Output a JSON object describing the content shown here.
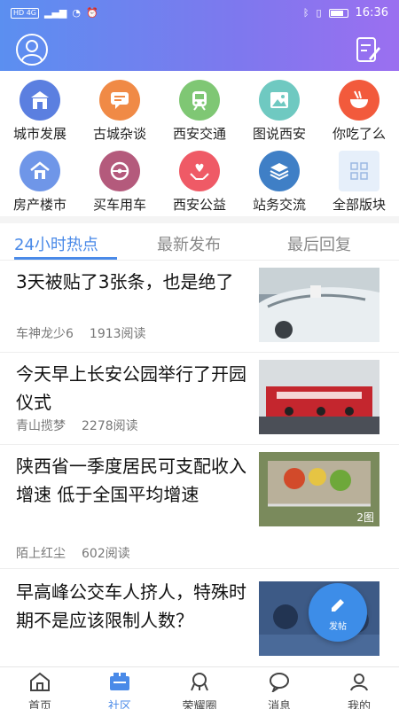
{
  "status_bar": {
    "left": "HD 4G",
    "time": "16:36"
  },
  "colors": {
    "accent": "#4a8ae8",
    "header_start": "#5b8ff0",
    "header_end": "#9b6ff0"
  },
  "header": {
    "profile_icon": "user-avatar-icon",
    "post_icon": "edit-note-icon"
  },
  "categories": [
    {
      "label": "城市发展",
      "icon": "city-gate-icon",
      "color": "#5b7fe0"
    },
    {
      "label": "古城杂谈",
      "icon": "chat-bubble-icon",
      "color": "#f08a46"
    },
    {
      "label": "西安交通",
      "icon": "train-icon",
      "color": "#7fc774"
    },
    {
      "label": "图说西安",
      "icon": "picture-icon",
      "color": "#6fc9c1"
    },
    {
      "label": "你吃了么",
      "icon": "noodle-bowl-icon",
      "color": "#f25a3c"
    },
    {
      "label": "房产楼市",
      "icon": "house-icon",
      "color": "#6f96e8"
    },
    {
      "label": "买车用车",
      "icon": "steering-wheel-icon",
      "color": "#b45a7c"
    },
    {
      "label": "西安公益",
      "icon": "heart-hands-icon",
      "color": "#ef5a66"
    },
    {
      "label": "站务交流",
      "icon": "layers-icon",
      "color": "#3f7fc6"
    },
    {
      "label": "全部版块",
      "icon": "grid-icon",
      "color": "#b9d2f2"
    }
  ],
  "tabs": [
    {
      "label": "24小时热点",
      "active": true
    },
    {
      "label": "最新发布",
      "active": false
    },
    {
      "label": "最后回复",
      "active": false
    }
  ],
  "feed": [
    {
      "title": "3天被贴了3张条，也是绝了",
      "author": "车神龙少6",
      "reads": "1913阅读",
      "badge": ""
    },
    {
      "title": "今天早上长安公园举行了开园仪式",
      "author": "青山揽梦",
      "reads": "2278阅读",
      "badge": ""
    },
    {
      "title": "陕西省一季度居民可支配收入增速 低于全国平均增速",
      "author": "陌上红尘",
      "reads": "602阅读",
      "badge": "2图"
    },
    {
      "title": "早高峰公交车人挤人，特殊时期不是应该限制人数？",
      "author": "",
      "reads": "",
      "badge": ""
    }
  ],
  "fab": {
    "label": "发帖"
  },
  "bottom_nav": [
    {
      "label": "首页",
      "active": false
    },
    {
      "label": "社区",
      "active": true
    },
    {
      "label": "荣耀圈",
      "active": false
    },
    {
      "label": "消息",
      "active": false
    },
    {
      "label": "我的",
      "active": false
    }
  ]
}
